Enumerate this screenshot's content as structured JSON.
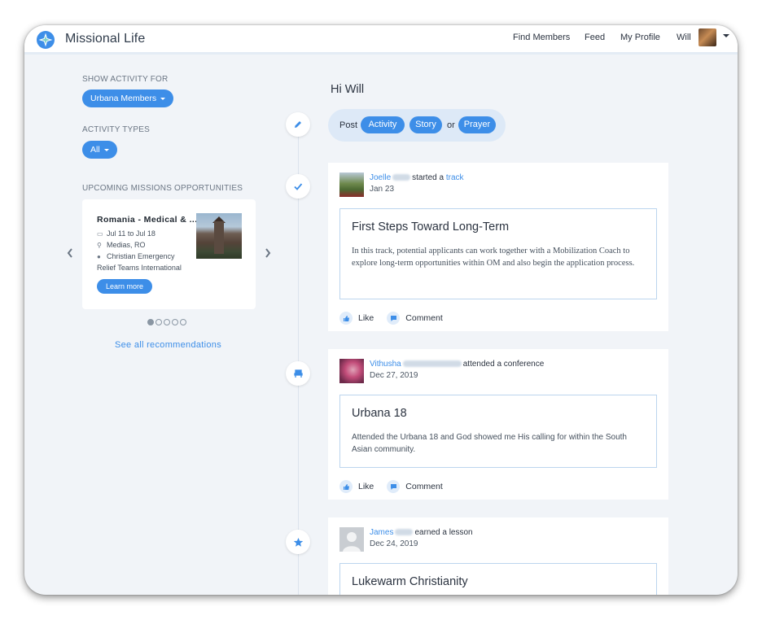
{
  "app": {
    "title": "Missional Life"
  },
  "nav": {
    "find_members": "Find Members",
    "feed": "Feed",
    "my_profile": "My Profile",
    "user_name": "Will"
  },
  "sidebar": {
    "show_activity_label": "SHOW ACTIVITY FOR",
    "show_activity_value": "Urbana Members",
    "activity_types_label": "ACTIVITY TYPES",
    "activity_types_value": "All",
    "upcoming_label": "UPCOMING MISSIONS OPPORTUNITIES",
    "opportunity": {
      "title": "Romania - Medical & ...",
      "dates": "Jul 11 to Jul 18",
      "location": "Medias, RO",
      "org_line1": "Christian Emergency",
      "org_line2": "Relief Teams International",
      "cta": "Learn more"
    },
    "carousel": {
      "count": 5,
      "active": 0
    },
    "see_all": "See all recommendations"
  },
  "main": {
    "greeting": "Hi Will",
    "post": {
      "label": "Post",
      "activity": "Activity",
      "story": "Story",
      "or": "or",
      "prayer": "Prayer"
    }
  },
  "feed": [
    {
      "name": "Joelle",
      "verb": "started a",
      "object": "track",
      "date": "Jan 23",
      "title": "First Steps Toward Long-Term",
      "body": "In this track, potential applicants can work together with a Mobilization Coach to explore long-term opportunities within OM and also begin the application process.",
      "like": "Like",
      "comment": "Comment"
    },
    {
      "name": "Vithusha",
      "verb": "attended a conference",
      "date": "Dec 27, 2019",
      "title": "Urbana 18",
      "body": "Attended the Urbana 18 and God showed me His calling for within the South Asian community.",
      "like": "Like",
      "comment": "Comment"
    },
    {
      "name": "James",
      "verb": "earned a lesson",
      "date": "Dec 24, 2019",
      "title": "Lukewarm Christianity"
    }
  ],
  "colors": {
    "accent": "#3d8ee8",
    "background": "#f1f4f8",
    "pill_bg": "#dde9f7"
  }
}
